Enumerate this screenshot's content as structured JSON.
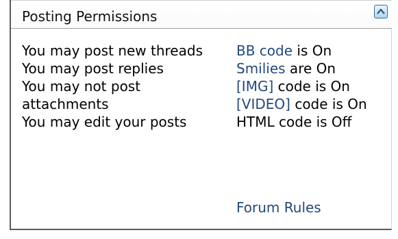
{
  "panel": {
    "title": "Posting Permissions",
    "collapse_icon": "collapse-icon"
  },
  "permissions": [
    "You may post new threads",
    "You may post replies",
    "You may not post attachments",
    "You may edit your posts"
  ],
  "codes": {
    "bb_link": "BB code",
    "bb_status": " is On",
    "smilies_link": "Smilies",
    "smilies_status": " are On",
    "img_link": "[IMG]",
    "img_status": " code is On",
    "video_link": "[VIDEO]",
    "video_status": " code is On",
    "html_text": "HTML code is Off"
  },
  "forum_rules": "Forum Rules",
  "colors": {
    "link": "#22497a",
    "border": "#5a5a5a"
  }
}
